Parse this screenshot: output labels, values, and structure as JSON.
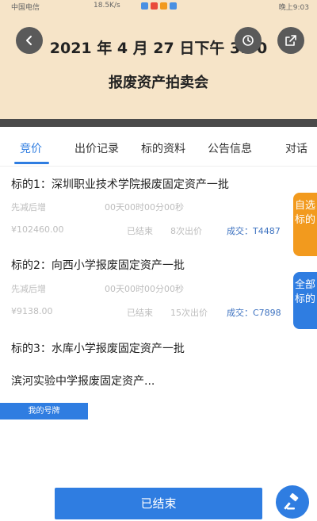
{
  "status_bar": {
    "carrier": "中国电信",
    "speed": "18.5K/s",
    "time_text": "晚上9:03"
  },
  "header": {
    "title_line1": "2021 年 4 月 27 日下午 3:00",
    "title_line2": "报废资产拍卖会",
    "back_icon": "chevron-left-icon",
    "clock_icon": "clock-icon",
    "share_icon": "share-icon"
  },
  "tabs": [
    {
      "label": "竞价",
      "active": true
    },
    {
      "label": "出价记录",
      "active": false
    },
    {
      "label": "标的资料",
      "active": false
    },
    {
      "label": "公告信息",
      "active": false
    },
    {
      "label": "对话",
      "active": false
    }
  ],
  "lots": [
    {
      "title": "标的1：深圳职业技术学院报废固定资产一批",
      "mode": "先减后增",
      "countdown": "00天00时00分00秒",
      "price": "¥102460.00",
      "status": "已结束",
      "bids": "8次出价",
      "deal": "成交：T4487"
    },
    {
      "title": "标的2：向西小学报废固定资产一批",
      "mode": "先减后增",
      "countdown": "00天00时00分00秒",
      "price": "¥9138.00",
      "status": "已结束",
      "bids": "15次出价",
      "deal": "成交：C7898"
    },
    {
      "title": "标的3：水库小学报废固定资产一批"
    }
  ],
  "partial_item": "滨河实验中学报废固定资产...",
  "my_tag": "我的号牌",
  "side_buttons": {
    "self_selected": "自选标的",
    "all": "全部标的"
  },
  "bottom_button": "已结束",
  "fab_icon": "gavel-icon",
  "colors": {
    "accent": "#2f7de1",
    "orange": "#f29a1e",
    "header_bg": "#f6e4c8"
  }
}
